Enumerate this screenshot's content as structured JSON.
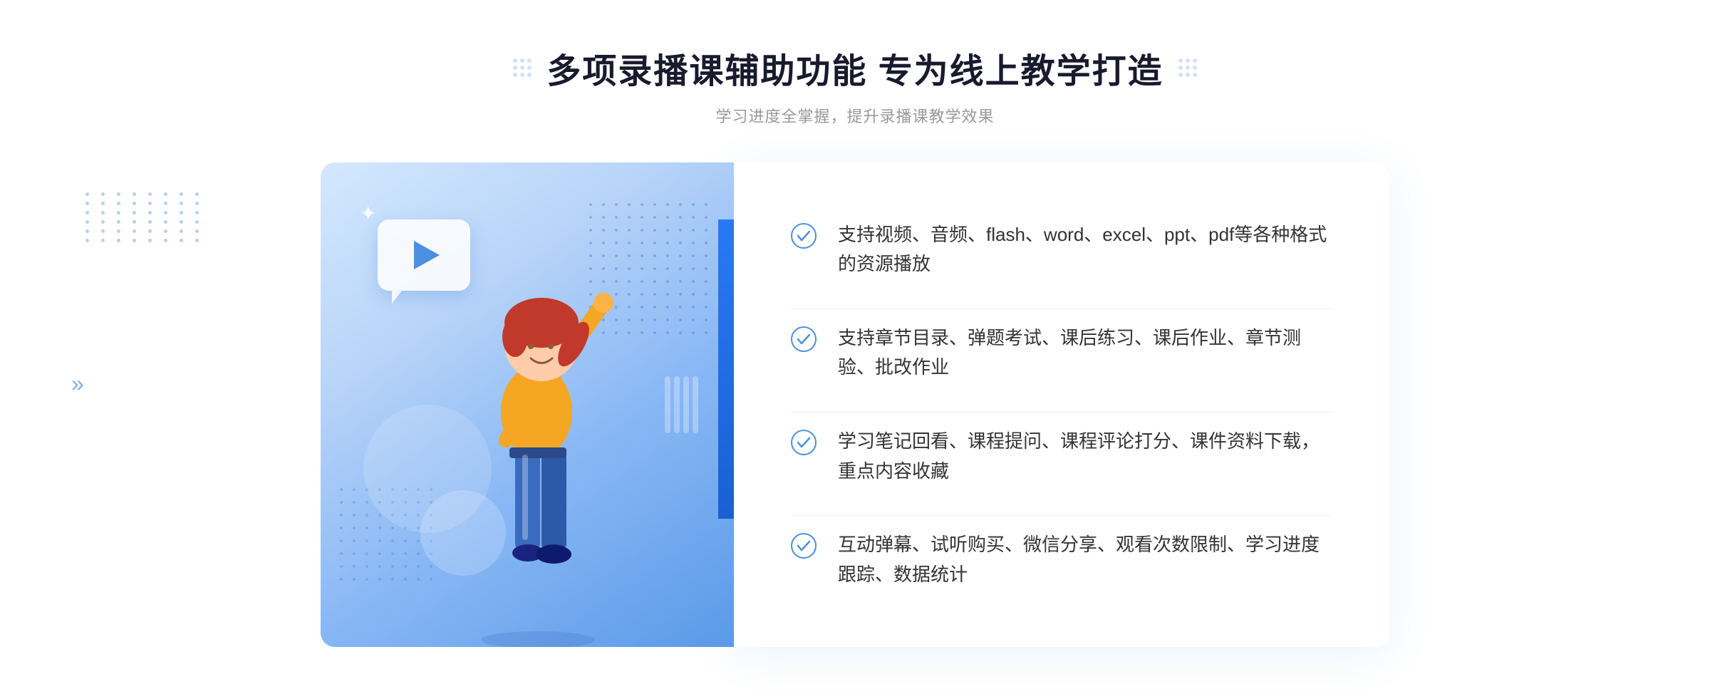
{
  "header": {
    "title": "多项录播课辅助功能 专为线上教学打造",
    "subtitle": "学习进度全掌握，提升录播课教学效果",
    "dots_left_icon": "decorative-dots-icon",
    "dots_right_icon": "decorative-dots-icon"
  },
  "features": [
    {
      "id": 1,
      "text": "支持视频、音频、flash、word、excel、ppt、pdf等各种格式的资源播放"
    },
    {
      "id": 2,
      "text": "支持章节目录、弹题考试、课后练习、课后作业、章节测验、批改作业"
    },
    {
      "id": 3,
      "text": "学习笔记回看、课程提问、课程评论打分、课件资料下载，重点内容收藏"
    },
    {
      "id": 4,
      "text": "互动弹幕、试听购买、微信分享、观看次数限制、学习进度跟踪、数据统计"
    }
  ],
  "colors": {
    "accent_blue": "#4a90e2",
    "dark_blue": "#2979f5",
    "title_color": "#1a1a2e",
    "text_color": "#333333",
    "subtitle_color": "#999999",
    "check_color": "#4a90e2"
  }
}
